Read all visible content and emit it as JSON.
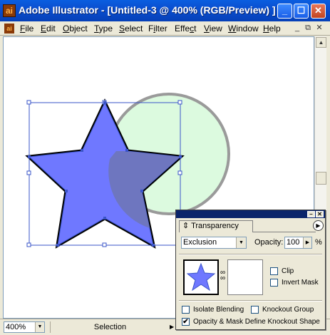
{
  "window": {
    "title": "Adobe Illustrator - [Untitled-3 @ 400% (RGB/Preview) ]",
    "minimize_glyph": "_",
    "maximize_glyph": "☐",
    "close_glyph": "✕"
  },
  "menu": {
    "items": [
      "File",
      "Edit",
      "Object",
      "Type",
      "Select",
      "Filter",
      "Effect",
      "View",
      "Window",
      "Help"
    ],
    "mnemonics": [
      "F",
      "E",
      "O",
      "T",
      "S",
      "i",
      "c",
      "V",
      "W",
      "H"
    ]
  },
  "status": {
    "zoom": "400%",
    "tool": "Selection"
  },
  "artwork": {
    "star_fill": "#6f78ff",
    "circle_fill": "#dcfadf",
    "circle_stroke": "#9a9a9a",
    "selection_color": "#3a54c8"
  },
  "transparency_panel": {
    "tab_label": "Transparency",
    "blend_mode": "Exclusion",
    "opacity_label": "Opacity:",
    "opacity_value": "100",
    "percent": "%",
    "clip_label": "Clip",
    "invert_mask_label": "Invert Mask",
    "isolate_blending_label": "Isolate Blending",
    "knockout_group_label": "Knockout Group",
    "opacity_mask_label": "Opacity & Mask Define Knockout Shape",
    "clip_checked": false,
    "invert_mask_checked": false,
    "isolate_blending_checked": false,
    "knockout_group_checked": false,
    "opacity_mask_checked": true
  }
}
